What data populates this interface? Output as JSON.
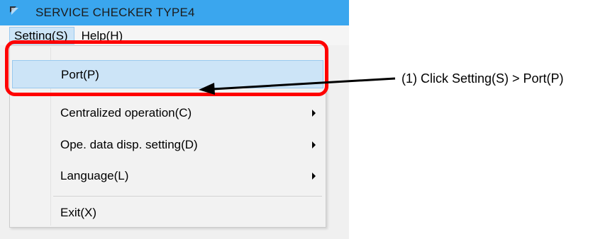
{
  "window": {
    "title": "SERVICE CHECKER TYPE4",
    "icon": "app-icon",
    "title_bar_color": "#3aa6ee"
  },
  "menu_bar": {
    "items": [
      {
        "label": "Setting(S)",
        "active": true
      },
      {
        "label": "Help(H)",
        "active": false
      }
    ]
  },
  "dropdown": {
    "items": [
      {
        "label": "Port(P)",
        "highlighted": true,
        "submenu": false
      },
      {
        "label": "Centralized operation(C)",
        "highlighted": false,
        "submenu": true
      },
      {
        "label": "Ope. data disp. setting(D)",
        "highlighted": false,
        "submenu": true
      },
      {
        "label": "Language(L)",
        "highlighted": false,
        "submenu": true
      },
      {
        "label": "Exit(X)",
        "highlighted": false,
        "submenu": false
      }
    ],
    "highlight_color": "#cce4f7"
  },
  "annotation": {
    "callout": "(1) Click Setting(S) > Port(P)",
    "outline_color": "#ff0000"
  }
}
